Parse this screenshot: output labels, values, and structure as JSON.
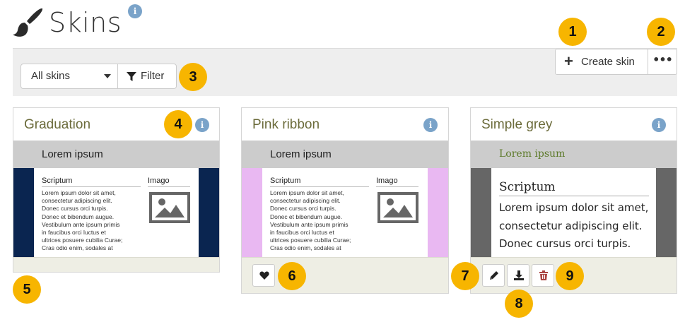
{
  "page": {
    "title": "Skins",
    "info_icon": "i",
    "icon": "paintbrush-icon"
  },
  "toolbar": {
    "select_value": "All skins",
    "filter_label": "Filter",
    "create_label": "Create skin",
    "more_label": "•••"
  },
  "callouts": [
    "1",
    "2",
    "3",
    "4",
    "5",
    "6",
    "7",
    "8",
    "9"
  ],
  "cards": [
    {
      "title": "Graduation",
      "info_icon": "i",
      "preview": {
        "header": "Lorem ipsum",
        "col1_title": "Scriptum",
        "col2_title": "Imago",
        "text": "Lorem ipsum dolor sit amet,\nconsectetur adipiscing elit.\nDonec cursus orci turpis.\nDonec et bibendum augue.\nVestibulum ante ipsum primis\nin faucibus orci luctus et\nultrices posuere cubilia Curae;\nCras odio enim, sodales at",
        "side_color": "#0a2550"
      }
    },
    {
      "title": "Pink ribbon",
      "info_icon": "i",
      "preview": {
        "header": "Lorem ipsum",
        "col1_title": "Scriptum",
        "col2_title": "Imago",
        "text": "Lorem ipsum dolor sit amet,\nconsectetur adipiscing elit.\nDonec cursus orci turpis.\nDonec et bibendum augue.\nVestibulum ante ipsum primis\nin faucibus orci luctus et\nultrices posuere cubilia Curae;\nCras odio enim, sodales at",
        "side_color": "#e9b8f2"
      },
      "favourite_icon": "heart-icon"
    },
    {
      "title": "Simple grey",
      "info_icon": "i",
      "preview": {
        "header": "Lorem ipsum",
        "col1_title": "Scriptum",
        "text": "Lorem ipsum dolor sit amet,\nconsectetur adipiscing elit.\nDonec cursus orci turpis.",
        "side_color": "#666666"
      },
      "actions": {
        "edit_icon": "pencil-icon",
        "export_icon": "download-icon",
        "delete_icon": "trash-icon"
      }
    }
  ]
}
